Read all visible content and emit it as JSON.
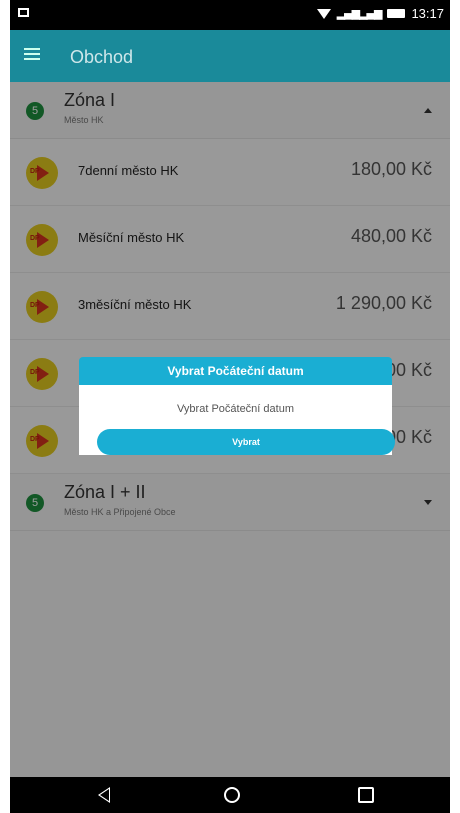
{
  "status_bar": {
    "time": "13:17",
    "signal": "▂▄▆▂▄▆"
  },
  "app_bar": {
    "title": "Obchod",
    "menu_icon": "hamburger-icon"
  },
  "zones": [
    {
      "badge": "5",
      "title": "Zóna I",
      "subtitle": "Město HK",
      "expanded": true
    },
    {
      "badge": "5",
      "title": "Zóna I + II",
      "subtitle": "Město HK a Připojené Obce",
      "expanded": false
    }
  ],
  "tickets": [
    {
      "name": "7denní město HK",
      "price": "180,00 Kč"
    },
    {
      "name": "Měsíční město HK",
      "price": "480,00 Kč"
    },
    {
      "name": "3měsíční město HK",
      "price": "1 290,00 Kč"
    },
    {
      "name": "",
      "price": ",00 Kč"
    },
    {
      "name": "",
      "price": ",00 Kč"
    }
  ],
  "ticket_logo_text": "DP",
  "dialog": {
    "title": "Vybrat Počáteční datum",
    "body": "Vybrat Počáteční datum",
    "button": "Vybrat"
  },
  "colors": {
    "app_bar": "#1a8a9a",
    "accent": "#1aaed3",
    "badge": "#1e8e3e"
  }
}
